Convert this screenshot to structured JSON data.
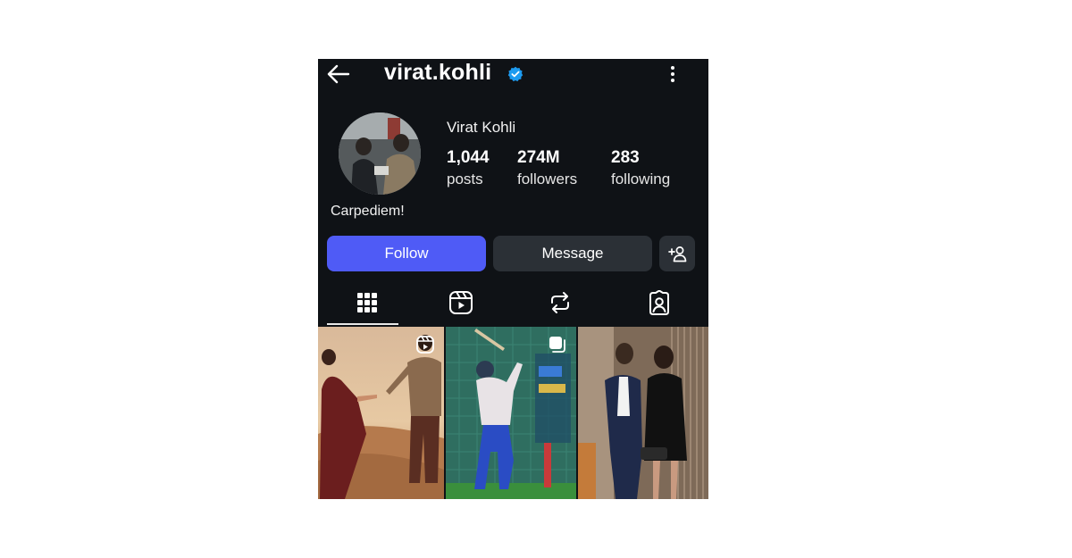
{
  "header": {
    "username": "virat.kohli",
    "back_icon": "arrow-left-icon",
    "verified_icon": "verified-badge-icon",
    "more_icon": "more-vertical-icon",
    "verified_color": "#1d9bf0"
  },
  "profile": {
    "display_name": "Virat Kohli",
    "bio": "Carpediem!",
    "stats": [
      {
        "value": "1,044",
        "label": "posts"
      },
      {
        "value": "274M",
        "label": "followers"
      },
      {
        "value": "283",
        "label": "following"
      }
    ]
  },
  "actions": {
    "follow_label": "Follow",
    "message_label": "Message",
    "add_user_icon": "add-person-icon",
    "follow_color": "#4f5bf6"
  },
  "tabs": [
    {
      "icon": "grid-icon",
      "selected": true
    },
    {
      "icon": "reels-icon",
      "selected": false
    },
    {
      "icon": "reposts-icon",
      "selected": false
    },
    {
      "icon": "tagged-icon",
      "selected": false
    }
  ],
  "posts": [
    {
      "badge": "reel-icon",
      "description": "couple-in-desert"
    },
    {
      "badge": "multi-post-icon",
      "description": "cricket-batting-practice"
    },
    {
      "badge": null,
      "description": "couple-formal-portrait"
    }
  ]
}
